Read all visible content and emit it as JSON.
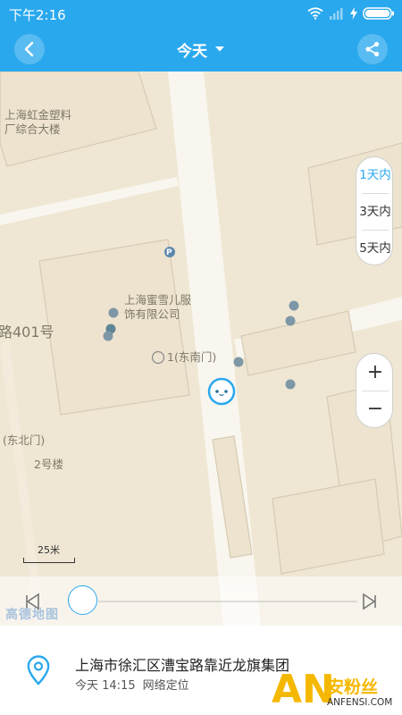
{
  "status_bar": {
    "time": "下午2:16",
    "icons": [
      "wifi-icon",
      "signal-icon",
      "charging-icon",
      "battery-icon"
    ]
  },
  "header": {
    "title": "今天",
    "back_icon": "chevron-left-icon",
    "dropdown_icon": "caret-down-icon",
    "share_icon": "share-icon"
  },
  "map": {
    "labels": {
      "building1": "上海虹金塑料",
      "building1_line2": "厂综合大楼",
      "company": "上海蜜雪儿服",
      "company_line2": "饰有限公司",
      "road": "路401号",
      "gate_south": "1(东南门)",
      "gate_north": "(东北门)",
      "building2": "2号楼",
      "parking": "P"
    },
    "day_filter": {
      "options": [
        "1天内",
        "3天内",
        "5天内"
      ],
      "selected": "1天内"
    },
    "zoom": {
      "in": "+",
      "out": "−"
    },
    "scale": "25米"
  },
  "playback": {
    "brand": "高德地图",
    "prev_icon": "step-back-icon",
    "next_icon": "step-forward-icon"
  },
  "location": {
    "address": "上海市徐汇区漕宝路靠近龙旗集团",
    "time": "今天 14:15",
    "method": "网络定位"
  },
  "watermark": {
    "logo": "AN",
    "name": "安粉丝",
    "url": "ANFENSI.COM"
  },
  "colors": {
    "accent": "#2aa8ee",
    "map_bg": "#efe7d4",
    "watermark": "#f5b800"
  }
}
